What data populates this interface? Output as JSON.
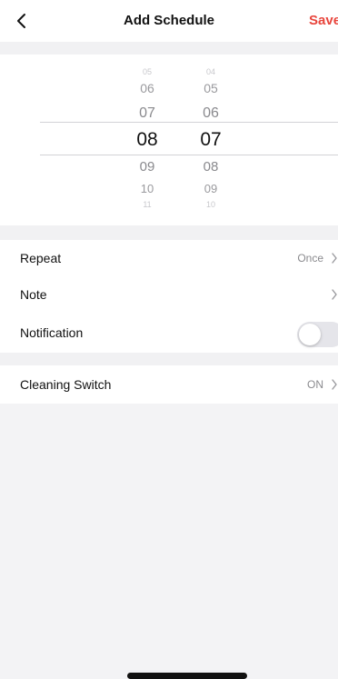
{
  "header": {
    "back_icon": "chevron-left-icon",
    "title": "Add Schedule",
    "save_label": "Save",
    "save_color": "#e8453c"
  },
  "picker": {
    "hours": [
      "05",
      "06",
      "07",
      "08",
      "09",
      "10",
      "11"
    ],
    "minutes": [
      "04",
      "05",
      "06",
      "07",
      "08",
      "09",
      "10"
    ],
    "selected_hour": "08",
    "selected_minute": "07"
  },
  "settings": {
    "repeat_label": "Repeat",
    "repeat_value": "Once",
    "note_label": "Note",
    "notification_label": "Notification",
    "notification_enabled": false,
    "cleaning_switch_label": "Cleaning Switch",
    "cleaning_switch_value": "ON",
    "chevron_icon": "chevron-right-icon"
  }
}
